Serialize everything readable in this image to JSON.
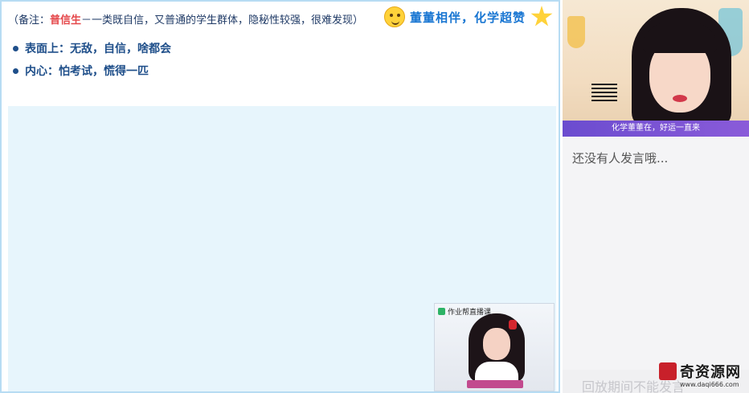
{
  "slide": {
    "note_prefix": "（备注：",
    "note_highlight": "普信生",
    "note_rest": "－一类既自信，又普通的学生群体，隐秘性较强，很难发现）",
    "slogan": "董董相伴，化学超赞",
    "bullets": [
      {
        "label": "表面上：无敌，自信，啥都会"
      },
      {
        "label": "内心：怕考试，慌得一匹"
      }
    ],
    "pip_label": "作业帮直播课"
  },
  "camera": {
    "banner": "化学董董在，好运一直来"
  },
  "chat": {
    "empty_text": "还没有人发言哦...",
    "bottom_text": "回放期间不能发言"
  },
  "watermark": {
    "text": "奇资源网",
    "url": "www.daqi666.com"
  },
  "colors": {
    "accent_blue": "#1976d2",
    "highlight_red": "#e5474a",
    "board_bg": "#e7f5fc",
    "banner_purple": "#6b4ccf"
  }
}
